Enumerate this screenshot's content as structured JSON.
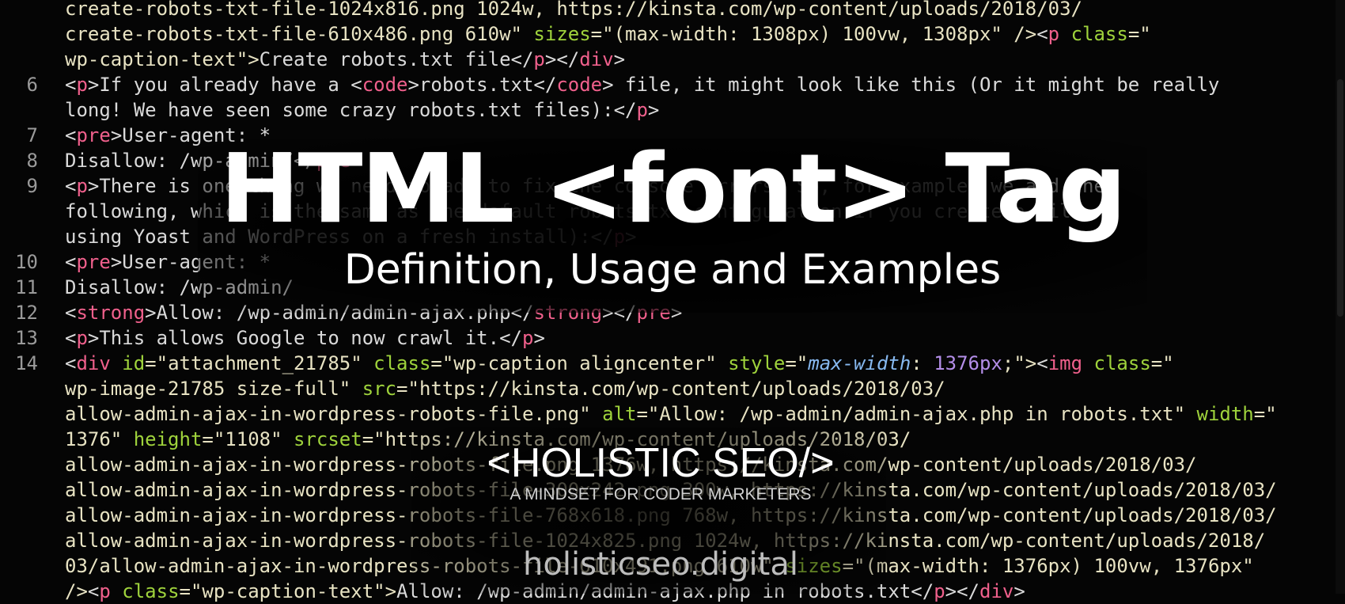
{
  "overlay": {
    "title": "HTML <font> Tag",
    "subtitle": "Definition, Usage and Examples",
    "brand": "<HOLISTIC SEO/>",
    "tagline": "A MINDSET FOR CODER  MARKETERS",
    "site": "holisticseo.digital"
  },
  "code_lines": [
    {
      "num": "",
      "segments": [
        {
          "t": "create-robots-txt-file-1024x816.png 1024w, https://kinsta.com/wp-content/uploads/2018/03/",
          "c": "str"
        }
      ]
    },
    {
      "num": "",
      "segments": [
        {
          "t": "create-robots-txt-file-610x486.png 610w\" ",
          "c": "str"
        },
        {
          "t": "sizes",
          "c": "attr"
        },
        {
          "t": "=\"(max-width: 1308px) 100vw, 1308px\" />",
          "c": "str"
        },
        {
          "t": "<",
          "c": "plain"
        },
        {
          "t": "p",
          "c": "tag"
        },
        {
          "t": " ",
          "c": "plain"
        },
        {
          "t": "class",
          "c": "attr"
        },
        {
          "t": "=\"",
          "c": "str"
        }
      ]
    },
    {
      "num": "",
      "segments": [
        {
          "t": "wp-caption-text\">",
          "c": "str"
        },
        {
          "t": "Create robots.txt file</",
          "c": "plain"
        },
        {
          "t": "p",
          "c": "tag"
        },
        {
          "t": "></",
          "c": "plain"
        },
        {
          "t": "div",
          "c": "tag"
        },
        {
          "t": ">",
          "c": "plain"
        }
      ]
    },
    {
      "num": "6",
      "segments": [
        {
          "t": "<",
          "c": "plain"
        },
        {
          "t": "p",
          "c": "tag"
        },
        {
          "t": ">If you already have a <",
          "c": "plain"
        },
        {
          "t": "code",
          "c": "tag"
        },
        {
          "t": ">robots.txt</",
          "c": "plain"
        },
        {
          "t": "code",
          "c": "tag"
        },
        {
          "t": "> file, it might look like this (Or it might be really",
          "c": "plain"
        }
      ]
    },
    {
      "num": "",
      "segments": [
        {
          "t": "long! We have seen some crazy robots.txt files):</",
          "c": "plain"
        },
        {
          "t": "p",
          "c": "tag"
        },
        {
          "t": ">",
          "c": "plain"
        }
      ]
    },
    {
      "num": "7",
      "segments": [
        {
          "t": "<",
          "c": "plain"
        },
        {
          "t": "pre",
          "c": "tag"
        },
        {
          "t": ">User-agent: *",
          "c": "plain"
        }
      ]
    },
    {
      "num": "8",
      "segments": [
        {
          "t": "Disallow: /wp-admin/</",
          "c": "plain"
        },
        {
          "t": "pre",
          "c": "tag"
        },
        {
          "t": ">",
          "c": "plain"
        }
      ]
    },
    {
      "num": "9",
      "segments": [
        {
          "t": "<",
          "c": "plain"
        },
        {
          "t": "p",
          "c": "tag"
        },
        {
          "t": ">There is one thing we need to add to fix the console errors. So, for example, we add the",
          "c": "plain"
        }
      ]
    },
    {
      "num": "",
      "segments": [
        {
          "t": "following, which is the same as the default robots.txt configuration if you create a file",
          "c": "plain"
        }
      ]
    },
    {
      "num": "",
      "segments": [
        {
          "t": "using Yoast and WordPress on a fresh install):</",
          "c": "plain"
        },
        {
          "t": "p",
          "c": "tag"
        },
        {
          "t": ">",
          "c": "plain"
        }
      ]
    },
    {
      "num": "10",
      "segments": [
        {
          "t": "<",
          "c": "plain"
        },
        {
          "t": "pre",
          "c": "tag"
        },
        {
          "t": ">User-agent: *",
          "c": "plain"
        }
      ]
    },
    {
      "num": "11",
      "segments": [
        {
          "t": "Disallow: /wp-admin/",
          "c": "plain"
        }
      ]
    },
    {
      "num": "12",
      "segments": [
        {
          "t": "<",
          "c": "plain"
        },
        {
          "t": "strong",
          "c": "tag"
        },
        {
          "t": ">Allow: /wp-admin/admin-ajax.php</",
          "c": "plain"
        },
        {
          "t": "strong",
          "c": "tag"
        },
        {
          "t": "></",
          "c": "plain"
        },
        {
          "t": "pre",
          "c": "tag"
        },
        {
          "t": ">",
          "c": "plain"
        }
      ]
    },
    {
      "num": "13",
      "segments": [
        {
          "t": "<",
          "c": "plain"
        },
        {
          "t": "p",
          "c": "tag"
        },
        {
          "t": ">This allows Google to now crawl it.</",
          "c": "plain"
        },
        {
          "t": "p",
          "c": "tag"
        },
        {
          "t": ">",
          "c": "plain"
        }
      ]
    },
    {
      "num": "14",
      "segments": [
        {
          "t": "<",
          "c": "plain"
        },
        {
          "t": "div",
          "c": "tag"
        },
        {
          "t": " ",
          "c": "plain"
        },
        {
          "t": "id",
          "c": "attr"
        },
        {
          "t": "=\"attachment_21785\" ",
          "c": "str"
        },
        {
          "t": "class",
          "c": "attr"
        },
        {
          "t": "=\"wp-caption aligncenter\" ",
          "c": "str"
        },
        {
          "t": "style",
          "c": "attr"
        },
        {
          "t": "=\"",
          "c": "str"
        },
        {
          "t": "max-width",
          "c": "kw"
        },
        {
          "t": ": ",
          "c": "str"
        },
        {
          "t": "1376px",
          "c": "num"
        },
        {
          "t": ";\">",
          "c": "str"
        },
        {
          "t": "<",
          "c": "plain"
        },
        {
          "t": "img",
          "c": "tag"
        },
        {
          "t": " ",
          "c": "plain"
        },
        {
          "t": "class",
          "c": "attr"
        },
        {
          "t": "=\"",
          "c": "str"
        }
      ]
    },
    {
      "num": "",
      "segments": [
        {
          "t": "wp-image-21785 size-full\" ",
          "c": "str"
        },
        {
          "t": "src",
          "c": "attr"
        },
        {
          "t": "=\"https://kinsta.com/wp-content/uploads/2018/03/",
          "c": "str"
        }
      ]
    },
    {
      "num": "",
      "segments": [
        {
          "t": "allow-admin-ajax-in-wordpress-robots-file.png\" ",
          "c": "str"
        },
        {
          "t": "alt",
          "c": "attr"
        },
        {
          "t": "=\"Allow: /wp-admin/admin-ajax.php in robots.txt\" ",
          "c": "str"
        },
        {
          "t": "width",
          "c": "attr"
        },
        {
          "t": "=\"",
          "c": "str"
        }
      ]
    },
    {
      "num": "",
      "segments": [
        {
          "t": "1376\" ",
          "c": "str"
        },
        {
          "t": "height",
          "c": "attr"
        },
        {
          "t": "=\"1108\" ",
          "c": "str"
        },
        {
          "t": "srcset",
          "c": "attr"
        },
        {
          "t": "=\"https://kinsta.com/wp-content/uploads/2018/03/",
          "c": "str"
        }
      ]
    },
    {
      "num": "",
      "segments": [
        {
          "t": "allow-admin-ajax-in-wordpress-robots-file.png 1376w, https://kinsta.com/wp-content/uploads/2018/03/",
          "c": "str"
        }
      ]
    },
    {
      "num": "",
      "segments": [
        {
          "t": "allow-admin-ajax-in-wordpress-robots-file-300x242.png 300w, https://kinsta.com/wp-content/uploads/2018/03/",
          "c": "str"
        }
      ]
    },
    {
      "num": "",
      "segments": [
        {
          "t": "allow-admin-ajax-in-wordpress-robots-file-768x618.png 768w, https://kinsta.com/wp-content/uploads/2018/03/",
          "c": "str"
        }
      ]
    },
    {
      "num": "",
      "segments": [
        {
          "t": "allow-admin-ajax-in-wordpress-robots-file-1024x825.png 1024w, https://kinsta.com/wp-content/uploads/2018/",
          "c": "str"
        }
      ]
    },
    {
      "num": "",
      "segments": [
        {
          "t": "03/allow-admin-ajax-in-wordpress-robots-file-610x491.png 610w\" ",
          "c": "str"
        },
        {
          "t": "sizes",
          "c": "attr"
        },
        {
          "t": "=\"(max-width: 1376px) 100vw, 1376px\"",
          "c": "str"
        }
      ]
    },
    {
      "num": "",
      "segments": [
        {
          "t": "/>",
          "c": "str"
        },
        {
          "t": "<",
          "c": "plain"
        },
        {
          "t": "p",
          "c": "tag"
        },
        {
          "t": " ",
          "c": "plain"
        },
        {
          "t": "class",
          "c": "attr"
        },
        {
          "t": "=\"wp-caption-text\">",
          "c": "str"
        },
        {
          "t": "Allow: /wp-admin/admin-ajax.php in robots.txt</",
          "c": "plain"
        },
        {
          "t": "p",
          "c": "tag"
        },
        {
          "t": "></",
          "c": "plain"
        },
        {
          "t": "div",
          "c": "tag"
        },
        {
          "t": ">",
          "c": "plain"
        }
      ]
    }
  ]
}
